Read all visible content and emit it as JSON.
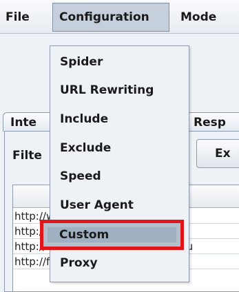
{
  "menubar": {
    "file_label": "File",
    "configuration_label": "Configuration",
    "mode_label": "Mode"
  },
  "tabs": {
    "left_label_partial": "Inte",
    "right_label_partial": "Resp"
  },
  "panel": {
    "filter_label_partial": "Filte",
    "export_label_partial": "Ex"
  },
  "table": {
    "rows": [
      "http://www.havaianas.com/xtra/",
      "http://www.havaianas.com/xtr",
      "http://www.havaianas.com/a/js/jqu",
      "http://fr-re.havaianas.com/xtra/"
    ]
  },
  "dropdown": {
    "items": [
      "Spider",
      "URL Rewriting",
      "Include",
      "Exclude",
      "Speed",
      "User Agent",
      "Custom",
      "Proxy"
    ],
    "selected": "Custom",
    "highlight_color": "#e0161b"
  }
}
